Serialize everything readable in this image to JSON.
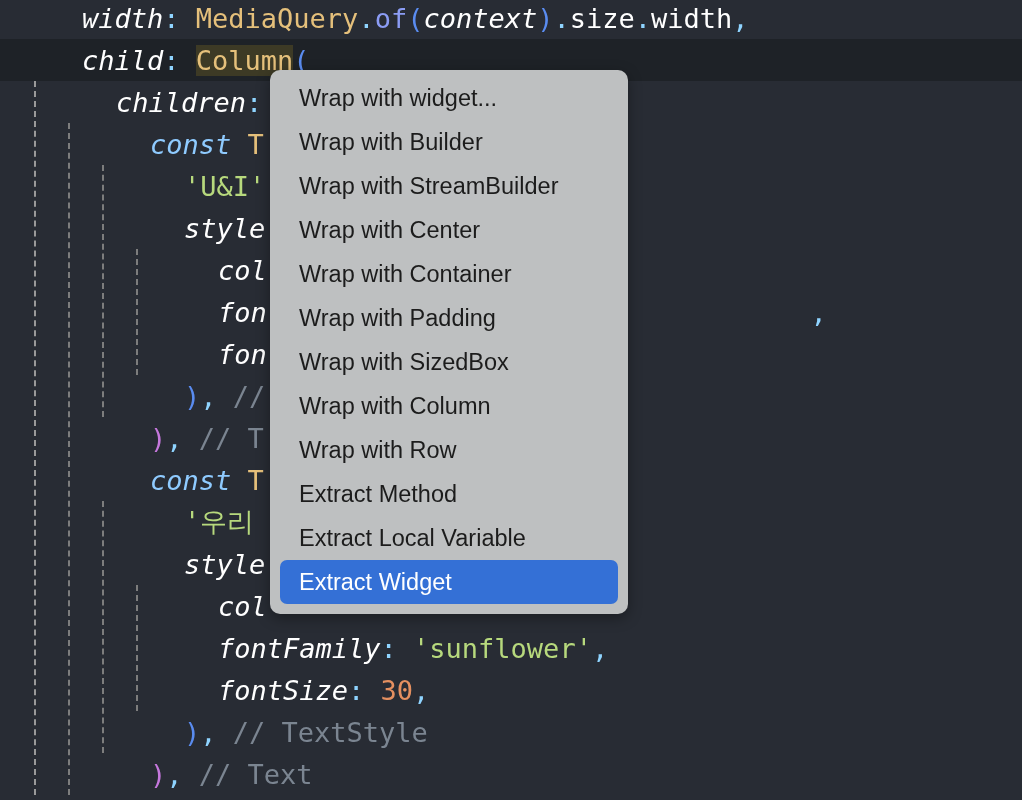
{
  "editor": {
    "lines": [
      {
        "tokens": [
          {
            "text": "width",
            "kind": "prop"
          },
          {
            "text": ": ",
            "kind": "punct"
          },
          {
            "text": "MediaQuery",
            "kind": "cls"
          },
          {
            "text": ".",
            "kind": "punct"
          },
          {
            "text": "of",
            "kind": "method"
          },
          {
            "text": "(",
            "kind": "paren"
          },
          {
            "text": "context",
            "kind": "prop"
          },
          {
            "text": ")",
            "kind": "paren"
          },
          {
            "text": ".",
            "kind": "punct"
          },
          {
            "text": "size",
            "kind": "plain"
          },
          {
            "text": ".",
            "kind": "punct"
          },
          {
            "text": "width",
            "kind": "plain"
          },
          {
            "text": ",",
            "kind": "punct"
          }
        ]
      },
      {
        "current": true,
        "tokens": [
          {
            "text": "child",
            "kind": "prop"
          },
          {
            "text": ": ",
            "kind": "punct"
          },
          {
            "text": "Column",
            "kind": "cls",
            "matched": true
          },
          {
            "text": "(",
            "kind": "paren"
          }
        ],
        "children": [
          {
            "tokens": [
              {
                "text": "children",
                "kind": "prop"
              },
              {
                "text": ":",
                "kind": "punct"
              }
            ],
            "children": [
              {
                "tokens": [
                  {
                    "text": "const",
                    "kind": "keyword"
                  },
                  {
                    "text": " T",
                    "kind": "cls"
                  }
                ],
                "children": [
                  {
                    "tokens": [
                      {
                        "text": "'U&I'",
                        "kind": "string"
                      }
                    ]
                  },
                  {
                    "tokens": [
                      {
                        "text": "style",
                        "kind": "prop"
                      }
                    ],
                    "children": [
                      {
                        "tokens": [
                          {
                            "text": "col",
                            "kind": "prop"
                          }
                        ]
                      },
                      {
                        "tokens": [
                          {
                            "text": "fon",
                            "kind": "prop"
                          },
                          {
                            "text": ",",
                            "kind": "punct",
                            "beyond_menu": true
                          }
                        ]
                      },
                      {
                        "tokens": [
                          {
                            "text": "fon",
                            "kind": "prop"
                          }
                        ]
                      }
                    ]
                  },
                  {
                    "tokens": [
                      {
                        "text": ")",
                        "kind": "paren"
                      },
                      {
                        "text": ", ",
                        "kind": "punct"
                      },
                      {
                        "text": "//",
                        "kind": "comment"
                      }
                    ]
                  }
                ]
              },
              {
                "tokens": [
                  {
                    "text": ")",
                    "kind": "paren2"
                  },
                  {
                    "text": ", ",
                    "kind": "punct"
                  },
                  {
                    "text": "// T",
                    "kind": "comment"
                  }
                ]
              },
              {
                "tokens": [
                  {
                    "text": "const",
                    "kind": "keyword"
                  },
                  {
                    "text": " T",
                    "kind": "cls"
                  }
                ],
                "children": [
                  {
                    "tokens": [
                      {
                        "text": "'우리 ",
                        "kind": "string"
                      }
                    ]
                  },
                  {
                    "tokens": [
                      {
                        "text": "style",
                        "kind": "prop"
                      }
                    ],
                    "children": [
                      {
                        "tokens": [
                          {
                            "text": "col",
                            "kind": "prop"
                          }
                        ]
                      },
                      {
                        "tokens": [
                          {
                            "text": "fontFamily",
                            "kind": "prop"
                          },
                          {
                            "text": ": ",
                            "kind": "punct"
                          },
                          {
                            "text": "'sunflower'",
                            "kind": "string"
                          },
                          {
                            "text": ",",
                            "kind": "punct"
                          }
                        ]
                      },
                      {
                        "tokens": [
                          {
                            "text": "fontSize",
                            "kind": "prop"
                          },
                          {
                            "text": ": ",
                            "kind": "punct"
                          },
                          {
                            "text": "30",
                            "kind": "number"
                          },
                          {
                            "text": ",",
                            "kind": "punct"
                          }
                        ]
                      }
                    ]
                  },
                  {
                    "tokens": [
                      {
                        "text": ")",
                        "kind": "paren"
                      },
                      {
                        "text": ", ",
                        "kind": "punct"
                      },
                      {
                        "text": "// TextStyle",
                        "kind": "comment"
                      }
                    ]
                  }
                ]
              },
              {
                "tokens": [
                  {
                    "text": ")",
                    "kind": "paren2"
                  },
                  {
                    "text": ", ",
                    "kind": "punct"
                  },
                  {
                    "text": "// Text",
                    "kind": "comment"
                  }
                ]
              }
            ]
          }
        ]
      }
    ]
  },
  "context_menu": {
    "items": [
      {
        "label": "Wrap with widget...",
        "selected": false
      },
      {
        "label": "Wrap with Builder",
        "selected": false
      },
      {
        "label": "Wrap with StreamBuilder",
        "selected": false
      },
      {
        "label": "Wrap with Center",
        "selected": false
      },
      {
        "label": "Wrap with Container",
        "selected": false
      },
      {
        "label": "Wrap with Padding",
        "selected": false
      },
      {
        "label": "Wrap with SizedBox",
        "selected": false
      },
      {
        "label": "Wrap with Column",
        "selected": false
      },
      {
        "label": "Wrap with Row",
        "selected": false
      },
      {
        "label": "Extract Method",
        "selected": false
      },
      {
        "label": "Extract Local Variable",
        "selected": false
      },
      {
        "label": "Extract Widget",
        "selected": true
      }
    ]
  }
}
